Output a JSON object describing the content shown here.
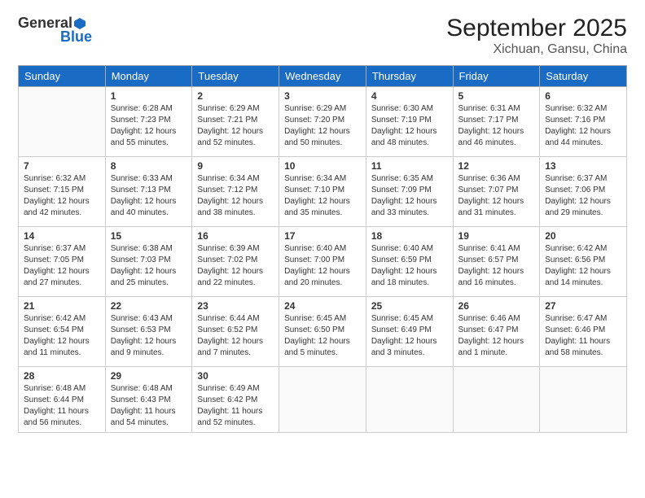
{
  "logo": {
    "general": "General",
    "blue": "Blue"
  },
  "header": {
    "title": "September 2025",
    "subtitle": "Xichuan, Gansu, China"
  },
  "weekdays": [
    "Sunday",
    "Monday",
    "Tuesday",
    "Wednesday",
    "Thursday",
    "Friday",
    "Saturday"
  ],
  "weeks": [
    [
      {
        "day": null
      },
      {
        "day": 1,
        "sunrise": "6:28 AM",
        "sunset": "7:23 PM",
        "daylight": "12 hours and 55 minutes."
      },
      {
        "day": 2,
        "sunrise": "6:29 AM",
        "sunset": "7:21 PM",
        "daylight": "12 hours and 52 minutes."
      },
      {
        "day": 3,
        "sunrise": "6:29 AM",
        "sunset": "7:20 PM",
        "daylight": "12 hours and 50 minutes."
      },
      {
        "day": 4,
        "sunrise": "6:30 AM",
        "sunset": "7:19 PM",
        "daylight": "12 hours and 48 minutes."
      },
      {
        "day": 5,
        "sunrise": "6:31 AM",
        "sunset": "7:17 PM",
        "daylight": "12 hours and 46 minutes."
      },
      {
        "day": 6,
        "sunrise": "6:32 AM",
        "sunset": "7:16 PM",
        "daylight": "12 hours and 44 minutes."
      }
    ],
    [
      {
        "day": 7,
        "sunrise": "6:32 AM",
        "sunset": "7:15 PM",
        "daylight": "12 hours and 42 minutes."
      },
      {
        "day": 8,
        "sunrise": "6:33 AM",
        "sunset": "7:13 PM",
        "daylight": "12 hours and 40 minutes."
      },
      {
        "day": 9,
        "sunrise": "6:34 AM",
        "sunset": "7:12 PM",
        "daylight": "12 hours and 38 minutes."
      },
      {
        "day": 10,
        "sunrise": "6:34 AM",
        "sunset": "7:10 PM",
        "daylight": "12 hours and 35 minutes."
      },
      {
        "day": 11,
        "sunrise": "6:35 AM",
        "sunset": "7:09 PM",
        "daylight": "12 hours and 33 minutes."
      },
      {
        "day": 12,
        "sunrise": "6:36 AM",
        "sunset": "7:07 PM",
        "daylight": "12 hours and 31 minutes."
      },
      {
        "day": 13,
        "sunrise": "6:37 AM",
        "sunset": "7:06 PM",
        "daylight": "12 hours and 29 minutes."
      }
    ],
    [
      {
        "day": 14,
        "sunrise": "6:37 AM",
        "sunset": "7:05 PM",
        "daylight": "12 hours and 27 minutes."
      },
      {
        "day": 15,
        "sunrise": "6:38 AM",
        "sunset": "7:03 PM",
        "daylight": "12 hours and 25 minutes."
      },
      {
        "day": 16,
        "sunrise": "6:39 AM",
        "sunset": "7:02 PM",
        "daylight": "12 hours and 22 minutes."
      },
      {
        "day": 17,
        "sunrise": "6:40 AM",
        "sunset": "7:00 PM",
        "daylight": "12 hours and 20 minutes."
      },
      {
        "day": 18,
        "sunrise": "6:40 AM",
        "sunset": "6:59 PM",
        "daylight": "12 hours and 18 minutes."
      },
      {
        "day": 19,
        "sunrise": "6:41 AM",
        "sunset": "6:57 PM",
        "daylight": "12 hours and 16 minutes."
      },
      {
        "day": 20,
        "sunrise": "6:42 AM",
        "sunset": "6:56 PM",
        "daylight": "12 hours and 14 minutes."
      }
    ],
    [
      {
        "day": 21,
        "sunrise": "6:42 AM",
        "sunset": "6:54 PM",
        "daylight": "12 hours and 11 minutes."
      },
      {
        "day": 22,
        "sunrise": "6:43 AM",
        "sunset": "6:53 PM",
        "daylight": "12 hours and 9 minutes."
      },
      {
        "day": 23,
        "sunrise": "6:44 AM",
        "sunset": "6:52 PM",
        "daylight": "12 hours and 7 minutes."
      },
      {
        "day": 24,
        "sunrise": "6:45 AM",
        "sunset": "6:50 PM",
        "daylight": "12 hours and 5 minutes."
      },
      {
        "day": 25,
        "sunrise": "6:45 AM",
        "sunset": "6:49 PM",
        "daylight": "12 hours and 3 minutes."
      },
      {
        "day": 26,
        "sunrise": "6:46 AM",
        "sunset": "6:47 PM",
        "daylight": "12 hours and 1 minute."
      },
      {
        "day": 27,
        "sunrise": "6:47 AM",
        "sunset": "6:46 PM",
        "daylight": "11 hours and 58 minutes."
      }
    ],
    [
      {
        "day": 28,
        "sunrise": "6:48 AM",
        "sunset": "6:44 PM",
        "daylight": "11 hours and 56 minutes."
      },
      {
        "day": 29,
        "sunrise": "6:48 AM",
        "sunset": "6:43 PM",
        "daylight": "11 hours and 54 minutes."
      },
      {
        "day": 30,
        "sunrise": "6:49 AM",
        "sunset": "6:42 PM",
        "daylight": "11 hours and 52 minutes."
      },
      {
        "day": null
      },
      {
        "day": null
      },
      {
        "day": null
      },
      {
        "day": null
      }
    ]
  ],
  "labels": {
    "sunrise": "Sunrise:",
    "sunset": "Sunset:",
    "daylight": "Daylight:"
  }
}
